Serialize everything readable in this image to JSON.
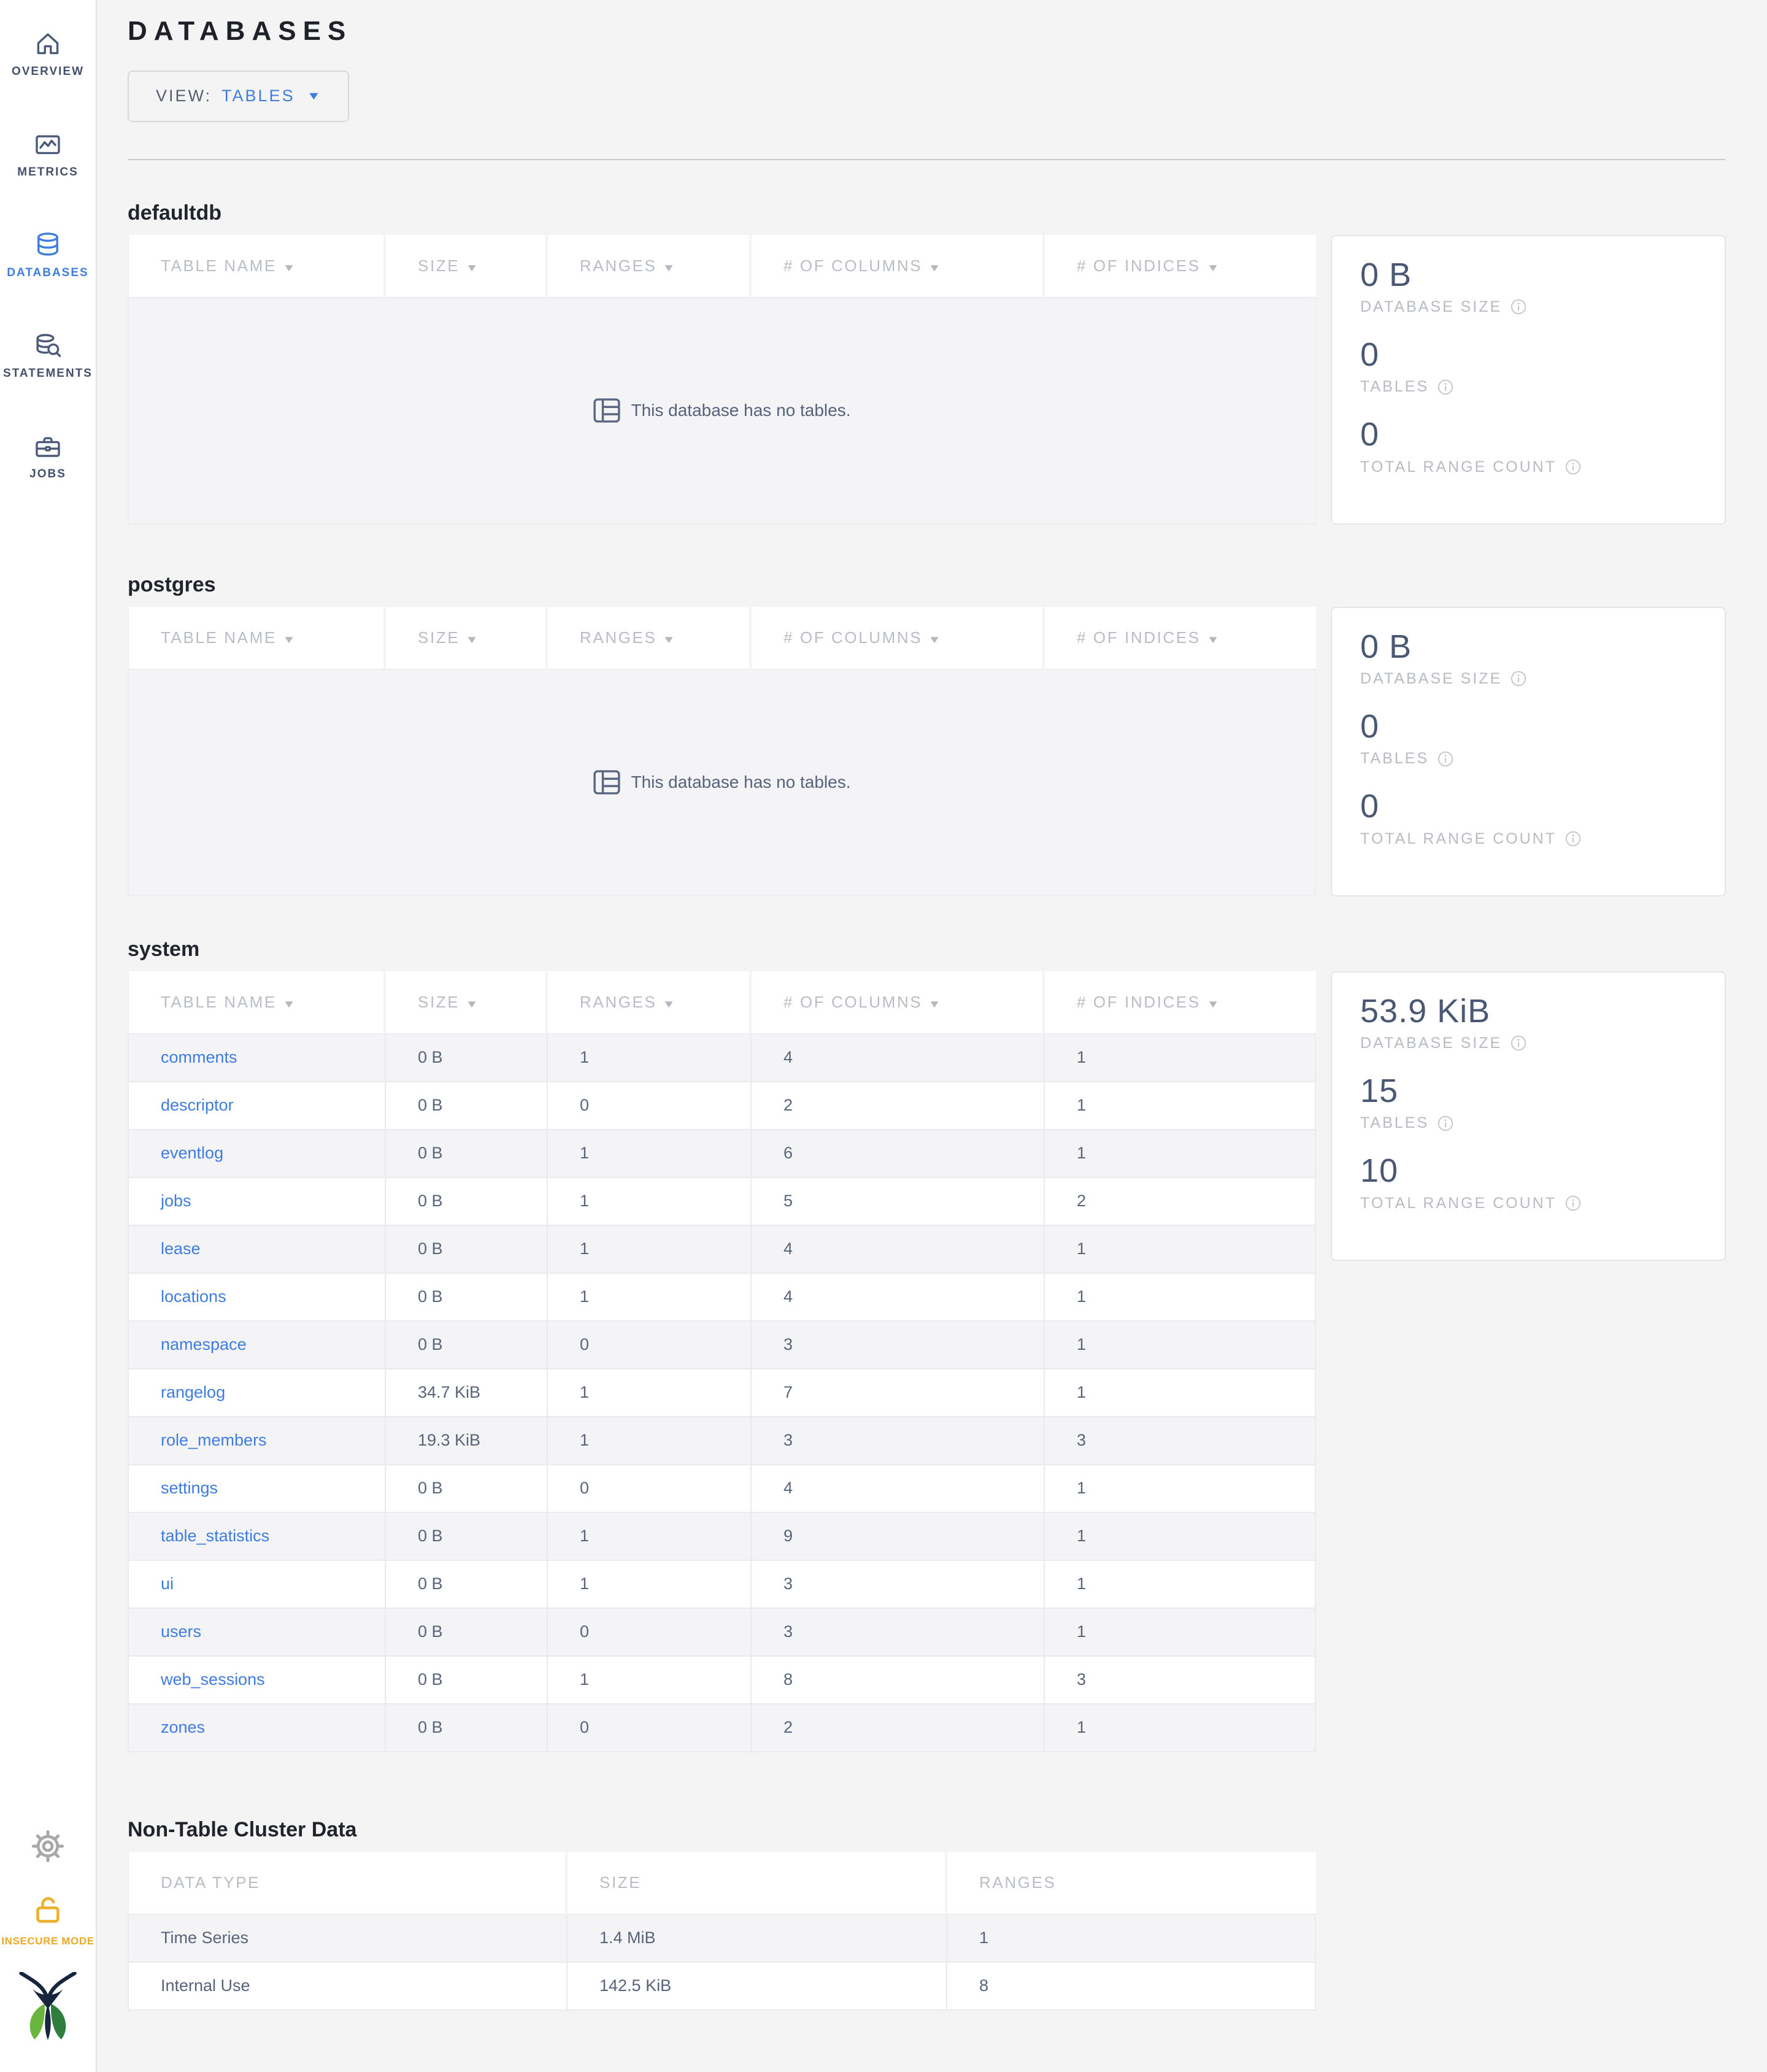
{
  "page": {
    "title": "DATABASES",
    "view_label": "VIEW:",
    "view_value": "TABLES",
    "empty_message": "This database has no tables."
  },
  "icons": {
    "sort_arrow": "▼",
    "view_caret": "▼"
  },
  "sidebar": {
    "items": [
      {
        "label": "OVERVIEW",
        "icon": "home-icon"
      },
      {
        "label": "METRICS",
        "icon": "metrics-icon"
      },
      {
        "label": "DATABASES",
        "icon": "databases-icon",
        "active": true
      },
      {
        "label": "STATEMENTS",
        "icon": "statements-icon"
      },
      {
        "label": "JOBS",
        "icon": "jobs-icon"
      }
    ],
    "insecure_label": "INSECURE MODE"
  },
  "table_columns": [
    "TABLE NAME",
    "SIZE",
    "RANGES",
    "# OF COLUMNS",
    "# OF INDICES"
  ],
  "stat_labels": {
    "size": "DATABASE SIZE",
    "tables": "TABLES",
    "ranges": "TOTAL RANGE COUNT"
  },
  "databases": [
    {
      "name": "defaultdb",
      "empty": true,
      "stats": {
        "size": "0 B",
        "tables": "0",
        "ranges": "0"
      }
    },
    {
      "name": "postgres",
      "empty": true,
      "stats": {
        "size": "0 B",
        "tables": "0",
        "ranges": "0"
      }
    },
    {
      "name": "system",
      "stats": {
        "size": "53.9 KiB",
        "tables": "15",
        "ranges": "10"
      },
      "rows": [
        {
          "name": "comments",
          "size": "0 B",
          "ranges": "1",
          "columns": "4",
          "indices": "1"
        },
        {
          "name": "descriptor",
          "size": "0 B",
          "ranges": "0",
          "columns": "2",
          "indices": "1"
        },
        {
          "name": "eventlog",
          "size": "0 B",
          "ranges": "1",
          "columns": "6",
          "indices": "1"
        },
        {
          "name": "jobs",
          "size": "0 B",
          "ranges": "1",
          "columns": "5",
          "indices": "2"
        },
        {
          "name": "lease",
          "size": "0 B",
          "ranges": "1",
          "columns": "4",
          "indices": "1"
        },
        {
          "name": "locations",
          "size": "0 B",
          "ranges": "1",
          "columns": "4",
          "indices": "1"
        },
        {
          "name": "namespace",
          "size": "0 B",
          "ranges": "0",
          "columns": "3",
          "indices": "1"
        },
        {
          "name": "rangelog",
          "size": "34.7 KiB",
          "ranges": "1",
          "columns": "7",
          "indices": "1"
        },
        {
          "name": "role_members",
          "size": "19.3 KiB",
          "ranges": "1",
          "columns": "3",
          "indices": "3"
        },
        {
          "name": "settings",
          "size": "0 B",
          "ranges": "0",
          "columns": "4",
          "indices": "1"
        },
        {
          "name": "table_statistics",
          "size": "0 B",
          "ranges": "1",
          "columns": "9",
          "indices": "1"
        },
        {
          "name": "ui",
          "size": "0 B",
          "ranges": "1",
          "columns": "3",
          "indices": "1"
        },
        {
          "name": "users",
          "size": "0 B",
          "ranges": "0",
          "columns": "3",
          "indices": "1"
        },
        {
          "name": "web_sessions",
          "size": "0 B",
          "ranges": "1",
          "columns": "8",
          "indices": "3"
        },
        {
          "name": "zones",
          "size": "0 B",
          "ranges": "0",
          "columns": "2",
          "indices": "1"
        }
      ]
    }
  ],
  "non_table": {
    "title": "Non-Table Cluster Data",
    "headers": [
      "DATA TYPE",
      "SIZE",
      "RANGES"
    ],
    "rows": [
      {
        "type": "Time Series",
        "size": "1.4 MiB",
        "ranges": "1"
      },
      {
        "type": "Internal Use",
        "size": "142.5 KiB",
        "ranges": "8"
      }
    ]
  },
  "colors": {
    "accent_blue": "#3e7ce0",
    "insecure_yellow": "#eaa825",
    "slate_text": "#4a5874",
    "logo_navy": "#17253f",
    "logo_green_light": "#69b53e",
    "logo_green_dark": "#2e7d3c"
  }
}
